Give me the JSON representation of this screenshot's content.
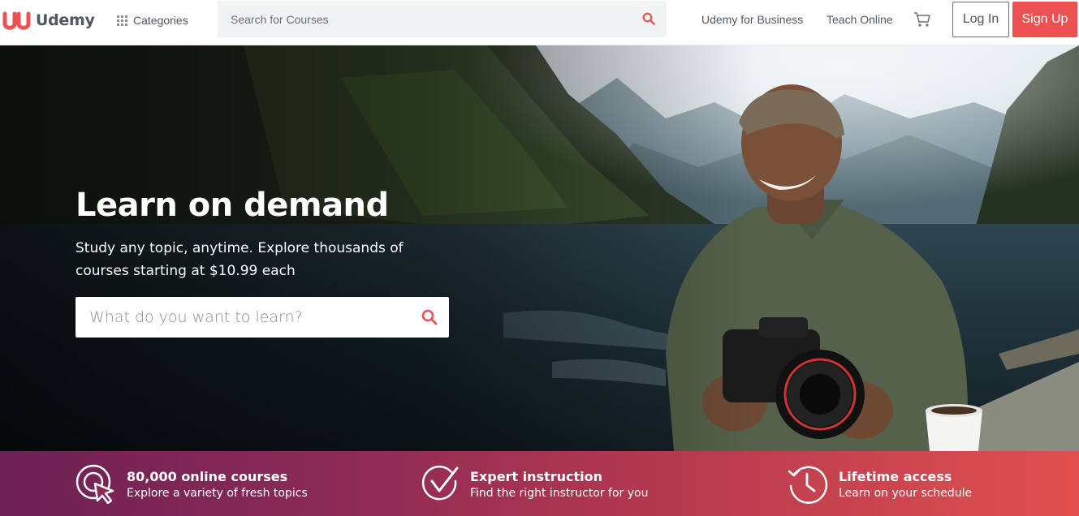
{
  "brand": {
    "name": "Udemy",
    "color": "#ec5252"
  },
  "header": {
    "categories_label": "Categories",
    "search_placeholder": "Search for Courses",
    "links": [
      "Udemy for Business",
      "Teach Online"
    ],
    "login_label": "Log In",
    "signup_label": "Sign Up"
  },
  "hero": {
    "title": "Learn on demand",
    "subtitle": "Study any topic, anytime. Explore thousands of courses starting at $10.99 each",
    "search_placeholder": "What do you want to learn?"
  },
  "value_props": [
    {
      "icon": "cursor-click-icon",
      "title": "80,000 online courses",
      "text": "Explore a variety of fresh topics"
    },
    {
      "icon": "checkmark-circle-icon",
      "title": "Expert instruction",
      "text": "Find the right instructor for you"
    },
    {
      "icon": "clock-history-icon",
      "title": "Lifetime access",
      "text": "Learn on your schedule"
    }
  ],
  "colors": {
    "accent": "#ec5252",
    "text": "#505763",
    "band_start": "#6e2155",
    "band_end": "#e0504f"
  }
}
